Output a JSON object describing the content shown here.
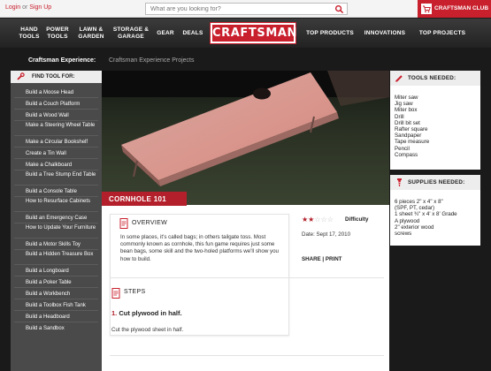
{
  "topbar": {
    "login": "Login",
    "or": "or",
    "signup": "Sign Up",
    "search_placeholder": "What are you looking for?",
    "club_label": "CRAFTSMAN CLUB"
  },
  "nav": {
    "items": [
      {
        "line1": "HAND",
        "line2": "TOOLS"
      },
      {
        "line1": "POWER",
        "line2": "TOOLS"
      },
      {
        "line1": "LAWN &",
        "line2": "GARDEN"
      },
      {
        "line1": "STORAGE &",
        "line2": "GARAGE"
      },
      {
        "line1": "GEAR",
        "line2": ""
      },
      {
        "line1": "DEALS",
        "line2": ""
      }
    ],
    "logo": "CRAFTSMAN",
    "right_items": [
      "TOP PRODUCTS",
      "INNOVATIONS",
      "TOP PROJECTS"
    ]
  },
  "breadcrumb": {
    "section": "Craftsman Experience:",
    "current": "Craftsman Experience Projects"
  },
  "sidebar": {
    "heading": "FIND TOOL FOR:",
    "items": [
      "Build a Moose Head",
      "Build a Couch Platform",
      "Build a Wood Wall",
      "Make a Steering Wheel Table",
      "Make a Circular Bookshelf",
      "Create a Tin Wall",
      "Make a Chalkboard",
      "Build a Tree Stump End Table",
      "Build a Console Table",
      "How to Resurface Cabinets",
      "Build an Emergency Case",
      "How to Update Your Furniture",
      "Build a Motor Skills Toy",
      "Build a Hidden Treasure Box",
      "Build a Longboard",
      "Build a Poker Table",
      "Build a Workbench",
      "Build a Toolbox Fish Tank",
      "Build a Headboard",
      "Build a Sandbox"
    ]
  },
  "project": {
    "title_tag": "CORNHOLE 101",
    "overview_heading": "OVERVIEW",
    "overview_text": "In some places, it's called bags; in others tailgate toss. Most commonly known as cornhole, this fun game requires just some bean bags, some skill and the two-holed platforms we'll show you how to build.",
    "difficulty_label": "Difficulty",
    "difficulty_stars": 2,
    "difficulty_max": 5,
    "date": "Date: Sept 17, 2010",
    "share": "SHARE",
    "share_sep": "|",
    "print": "PRINT",
    "steps_heading": "STEPS",
    "step1_num": "1.",
    "step1_title": "Cut plywood in half.",
    "step1_text": "Cut the plywood sheet in half."
  },
  "tools": {
    "heading": "TOOLS NEEDED:",
    "items": [
      "Miter saw",
      "Jig saw",
      "Miter box",
      "Drill",
      "Drill bit set",
      "Rafter square",
      "Sandpaper",
      "Tape measure",
      "Pencil",
      "Compass"
    ]
  },
  "supplies": {
    "heading": "SUPPLIES NEEDED:",
    "items": [
      "6 pieces 2\" x 4\" x 8\"",
      "(SPF, PT, cedar)",
      "1 sheet ¾\" x 4' x 8' Grade",
      "A plywood",
      "2\" exterior wood",
      "screws"
    ]
  },
  "colors": {
    "brand_red": "#c8202d",
    "dark_bg": "#1a1a1a",
    "sidebar_bg": "#4a4a4a"
  }
}
